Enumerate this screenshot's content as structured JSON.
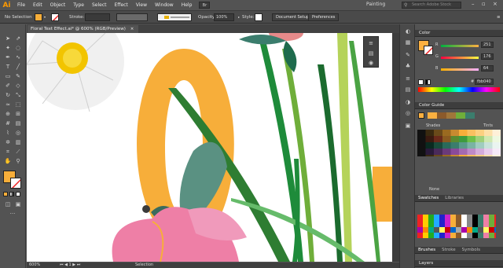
{
  "app": {
    "logo": "Ai",
    "workspace": "Painting",
    "search_placeholder": "Search Adobe Stock",
    "br_label": "Br"
  },
  "menu": [
    "File",
    "Edit",
    "Object",
    "Type",
    "Select",
    "Effect",
    "View",
    "Window",
    "Help"
  ],
  "control": {
    "selection_label": "No Selection",
    "stroke_label": "Stroke:",
    "opacity_label": "Opacity:",
    "opacity_value": "100%",
    "style_label": "Style:",
    "document_setup": "Document Setup",
    "preferences": "Preferences",
    "fill_color": "#f7ae3a"
  },
  "document": {
    "tab_title": "Floral Text Effect.ai* @ 600% (RGB/Preview)",
    "close": "×",
    "zoom": "600%",
    "status": "Selection"
  },
  "color_panel": {
    "title": "Color",
    "channels": [
      {
        "label": "R",
        "value": "251",
        "gradient": "linear-gradient(90deg,#00b040,#ffb040)"
      },
      {
        "label": "G",
        "value": "176",
        "gradient": "linear-gradient(90deg,#fb0040,#fbff40)"
      },
      {
        "label": "B",
        "value": "64",
        "gradient": "linear-gradient(90deg,#fbb000,#fbb0ff)"
      }
    ],
    "hex_prefix": "#",
    "hex": "fbb040",
    "swatch": "#fbb040"
  },
  "guide_panel": {
    "title": "Color Guide",
    "shades_label": "Shades",
    "tints_label": "Tints",
    "none_label": "None"
  },
  "swatches_panel": {
    "tabs": [
      "Swatches",
      "Libraries"
    ]
  },
  "bottom_tabs": [
    "Brushes",
    "Stroke",
    "Symbols"
  ],
  "layers_tab": "Layers"
}
